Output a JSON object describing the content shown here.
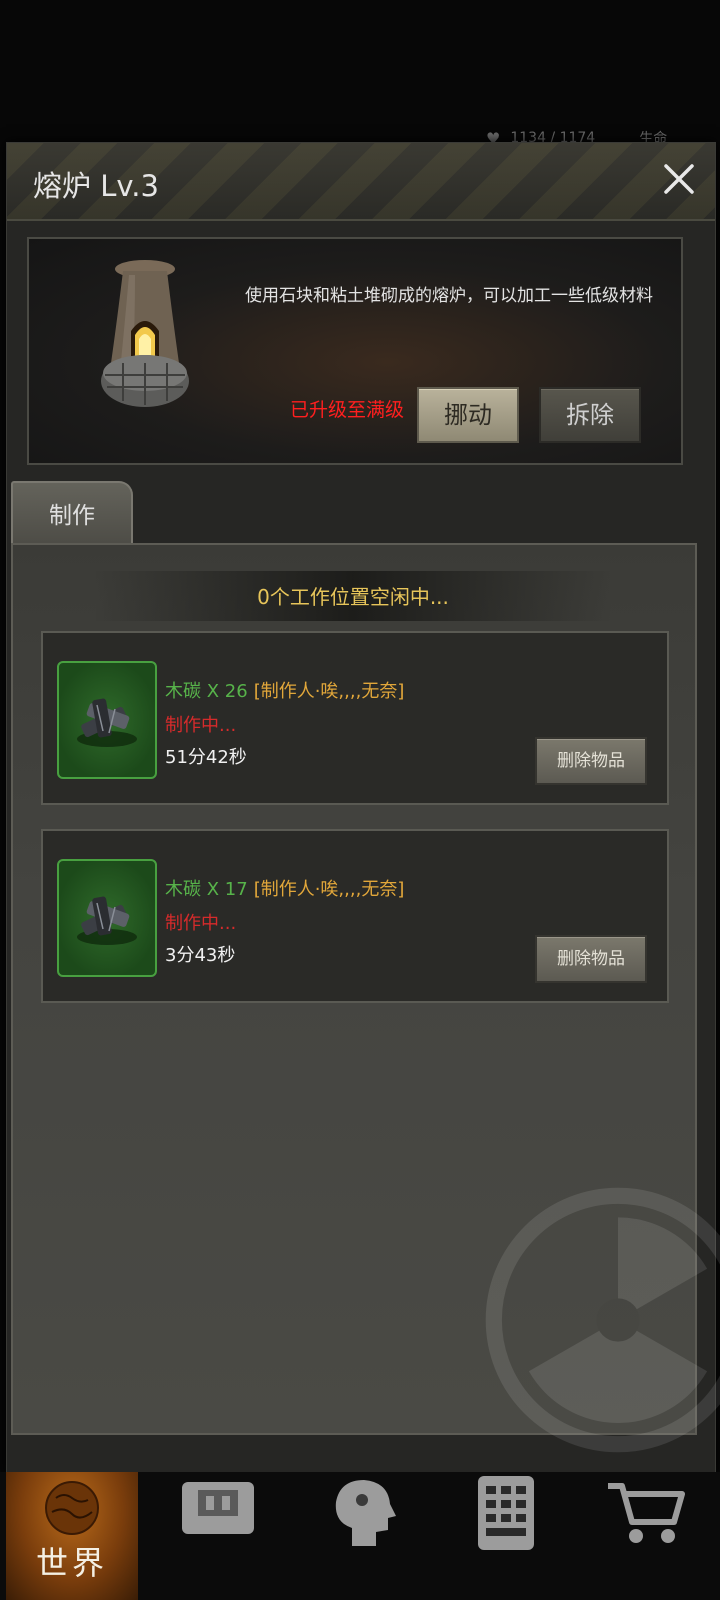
{
  "status_peek": {
    "hp_text": "1134 / 1174",
    "label": "生命"
  },
  "modal": {
    "title": "熔炉 Lv.3",
    "close_icon": "close-icon"
  },
  "building": {
    "description": "使用石块和粘土堆砌成的熔炉，可以加工一些低级材料",
    "max_level_text": "已升级至满级",
    "move_label": "挪动",
    "demolish_label": "拆除"
  },
  "tabs": [
    {
      "label": "制作",
      "active": true
    }
  ],
  "crafting": {
    "idle_slots_text": "0个工作位置空闲中...",
    "jobs": [
      {
        "item": "木碳 X 26",
        "maker": "[制作人·唉,,,,无奈]",
        "status": "制作中...",
        "time_left": "51分42秒",
        "delete_label": "删除物品",
        "icon": "charcoal-icon"
      },
      {
        "item": "木碳 X 17",
        "maker": "[制作人·唉,,,,无奈]",
        "status": "制作中...",
        "time_left": "3分43秒",
        "delete_label": "删除物品",
        "icon": "charcoal-icon"
      }
    ]
  },
  "bottom_nav": {
    "world_label": "世界",
    "items": [
      "world-globe-icon",
      "backpack-icon",
      "character-head-icon",
      "phone-icon",
      "shop-cart-icon"
    ]
  },
  "colors": {
    "accent_gold": "#e7c55a",
    "item_green": "#57b34a",
    "maker_orange": "#e2a73a",
    "status_red": "#d62b2b",
    "max_level_red": "#ff1f1f"
  }
}
